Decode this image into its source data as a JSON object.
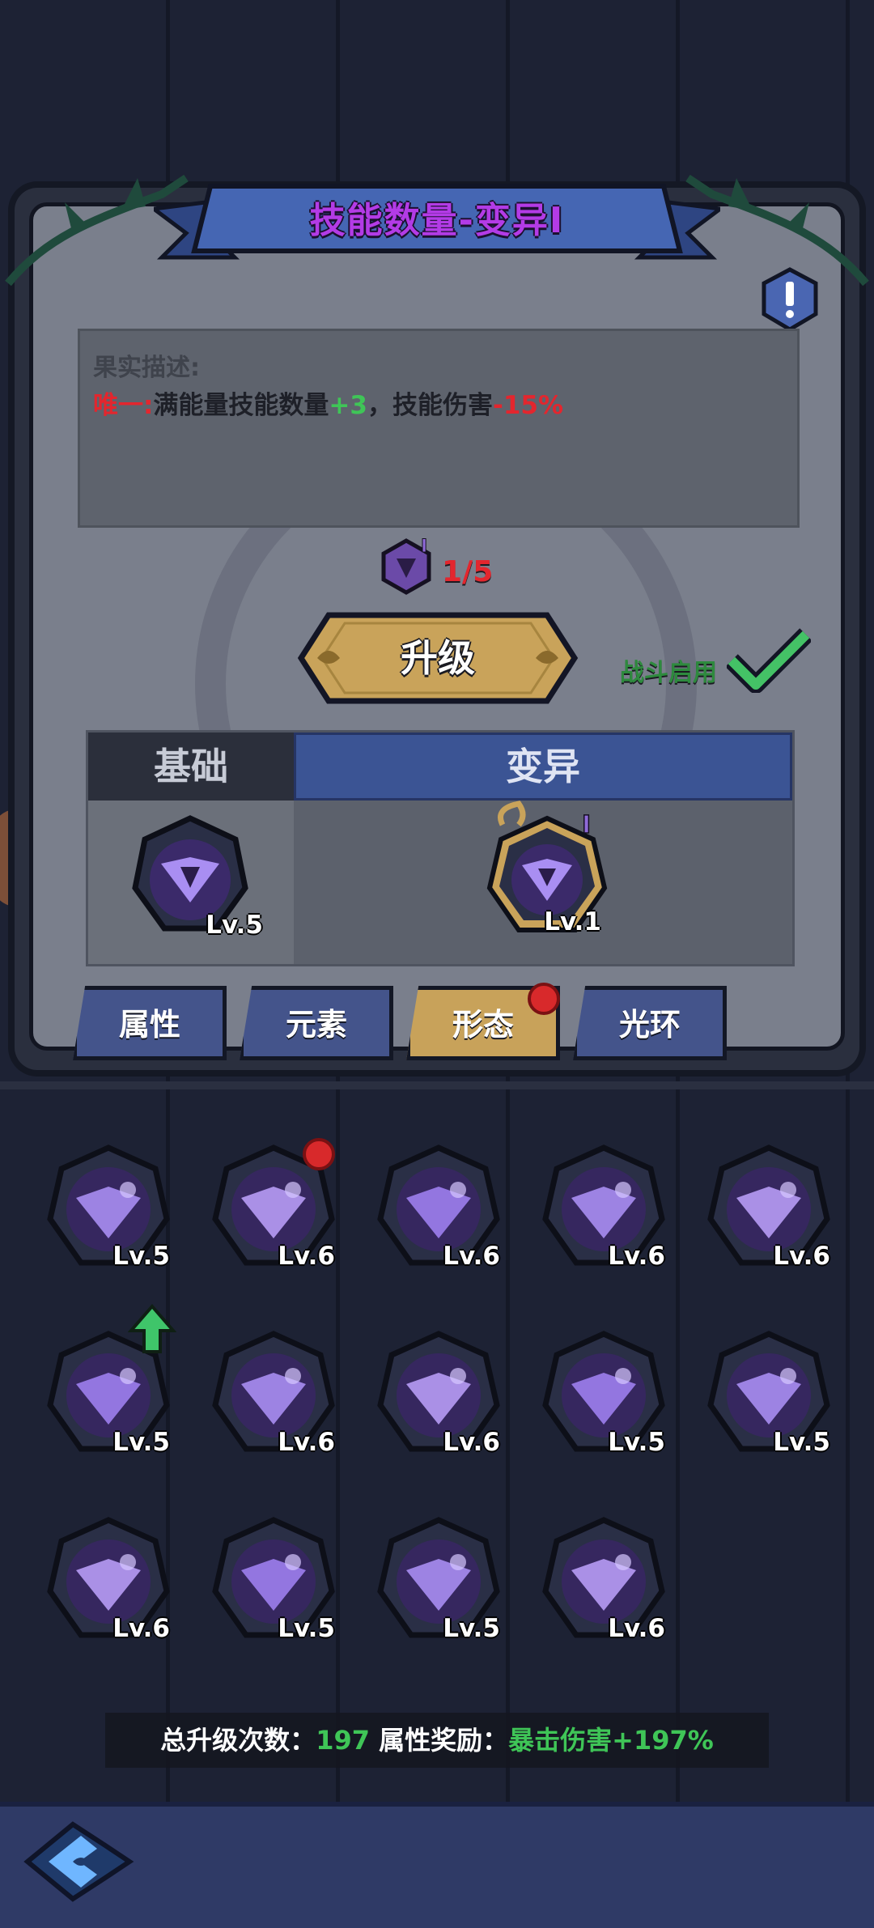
{
  "title": "技能数量-变异I",
  "description": {
    "heading": "果实描述:",
    "prefix": "唯一:",
    "text1": "满能量技能数量",
    "bonus": "+3",
    "text2": "，技能伤害",
    "penalty": "-15%"
  },
  "progress": "1/5",
  "upgrade_button": "升级",
  "battle_enable_label": "战斗启用",
  "compare": {
    "basic_header": "基础",
    "mutation_header": "变异",
    "basic_level": "Lv.5",
    "mutation_level": "Lv.1"
  },
  "tabs": [
    {
      "label": "属性",
      "active": false,
      "dot": false
    },
    {
      "label": "元素",
      "active": false,
      "dot": false
    },
    {
      "label": "形态",
      "active": true,
      "dot": true
    },
    {
      "label": "光环",
      "active": false,
      "dot": false
    }
  ],
  "skills": [
    {
      "level": "Lv.5",
      "icon": "split-shield-icon",
      "badge": ""
    },
    {
      "level": "Lv.6",
      "icon": "meteor-icon",
      "badge": "red-dot"
    },
    {
      "level": "Lv.6",
      "icon": "zigzag-icon",
      "badge": ""
    },
    {
      "level": "Lv.6",
      "icon": "beast-icon",
      "badge": ""
    },
    {
      "level": "Lv.6",
      "icon": "lightning-orb-icon",
      "badge": ""
    },
    {
      "level": "Lv.5",
      "icon": "split-arrow-icon",
      "badge": "green-arrow"
    },
    {
      "level": "Lv.6",
      "icon": "target-icon",
      "badge": ""
    },
    {
      "level": "Lv.6",
      "icon": "bubbles-icon",
      "badge": ""
    },
    {
      "level": "Lv.5",
      "icon": "hourglass-icon",
      "badge": ""
    },
    {
      "level": "Lv.5",
      "icon": "vortex-icon",
      "badge": ""
    },
    {
      "level": "Lv.6",
      "icon": "return-arrow-icon",
      "badge": ""
    },
    {
      "level": "Lv.5",
      "icon": "ninja-icon",
      "badge": ""
    },
    {
      "level": "Lv.5",
      "icon": "swirl-icon",
      "badge": ""
    },
    {
      "level": "Lv.6",
      "icon": "slash-icon",
      "badge": ""
    }
  ],
  "summary": {
    "upgrades_label": "总升级次数：",
    "upgrades_value": "197",
    "bonus_label": "属性奖励：",
    "bonus_value": "暴击伤害+197%"
  },
  "colors": {
    "accent_purple": "#b33be6",
    "bonus_green": "#3fc557",
    "penalty_red": "#e3262e",
    "tab_active": "#c8a25a"
  }
}
